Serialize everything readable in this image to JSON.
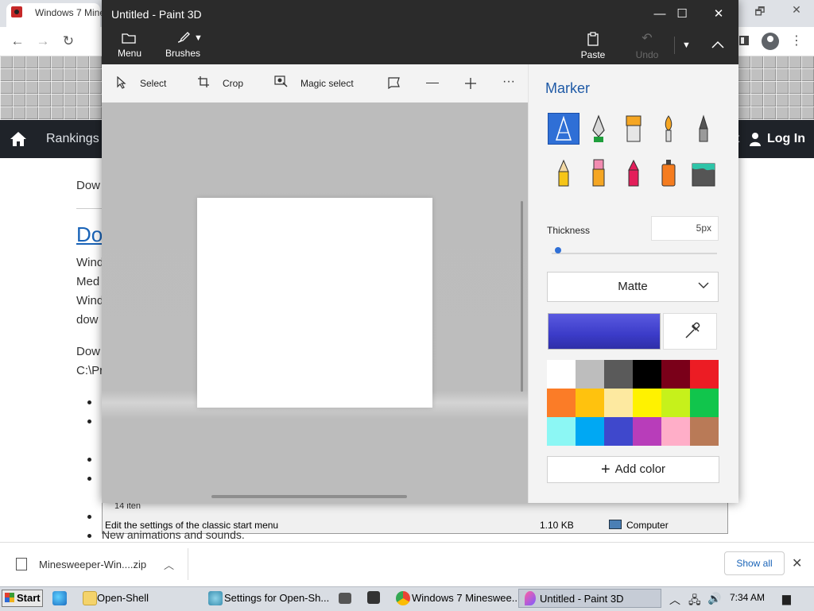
{
  "browser": {
    "tab_title": "Windows 7 Mine",
    "window_controls": [
      "🗗",
      "✕"
    ],
    "nav": {
      "back": "←",
      "forward": "→",
      "reload": "↻"
    }
  },
  "site": {
    "nav_item": "Rankings",
    "login": "Log In",
    "nav_partial_right": "t",
    "text_lines": [
      "Dow",
      "Wind",
      "Med",
      "Wind",
      "dow",
      "Dow",
      "C:\\Pr"
    ],
    "heading_link": "Do",
    "bullet_text": "New animations and sounds."
  },
  "explorer": {
    "items_text": "14 iten",
    "status_text": "Edit the settings of the classic start menu",
    "size_text": "1.10 KB",
    "location_text": "Computer"
  },
  "download_bar": {
    "file_name": "Minesweeper-Win....zip",
    "show_all": "Show all",
    "close": "✕"
  },
  "taskbar": {
    "start": "Start",
    "items": [
      {
        "label": "Open-Shell"
      },
      {
        "label": "Settings for Open-Sh..."
      },
      {
        "label": "Windows 7 Minesweе..."
      },
      {
        "label": "Untitled - Paint 3D"
      }
    ],
    "clock": "7:34 AM"
  },
  "paint3d": {
    "title": "Untitled - Paint 3D",
    "window_buttons": {
      "minimize": "—",
      "maximize": "☐",
      "close": "✕"
    },
    "ribbon": {
      "menu": "Menu",
      "brushes": "Brushes",
      "paste": "Paste",
      "undo": "Undo"
    },
    "tools": {
      "select": "Select",
      "crop": "Crop",
      "magic_select": "Magic select"
    },
    "panel": {
      "title": "Marker",
      "thickness_label": "Thickness",
      "thickness_value": "5px",
      "thickness_fraction": 0.03,
      "finish": "Matte",
      "add_color": "Add color",
      "brushes": [
        "marker",
        "calligraphy-pen",
        "oil-brush",
        "watercolor",
        "pixel-pen",
        "pencil",
        "eraser",
        "crayon",
        "spray-can",
        "fill"
      ],
      "selected_brush": "marker",
      "current_color": "#3b3bc8",
      "palette": [
        "#ffffff",
        "#bdbdbd",
        "#5a5a5a",
        "#000000",
        "#7a0019",
        "#ec1c24",
        "#fb7c27",
        "#ffc20e",
        "#fde9a0",
        "#fff200",
        "#c6f11b",
        "#11c54c",
        "#8cf7f4",
        "#00a8f3",
        "#3f48cc",
        "#b83dba",
        "#ffaec8",
        "#b97a57"
      ]
    }
  }
}
